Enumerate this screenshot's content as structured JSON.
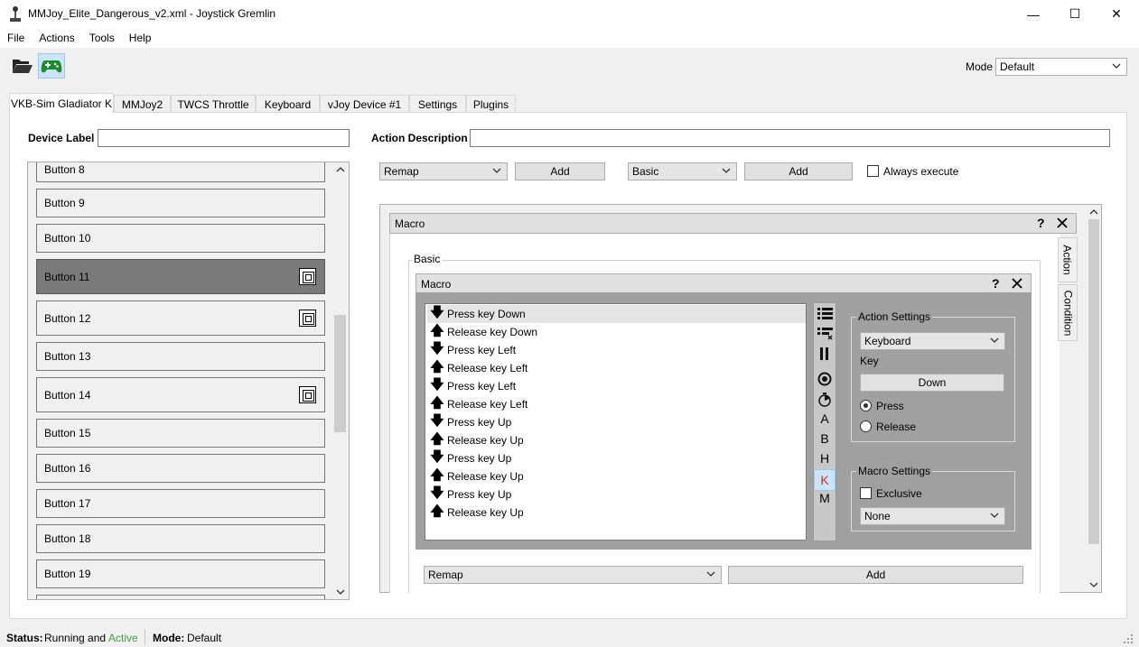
{
  "window": {
    "title": "MMJoy_Elite_Dangerous_v2.xml - Joystick Gremlin",
    "minimize": "—",
    "maximize": "☐",
    "close": "✕"
  },
  "menu": [
    "File",
    "Actions",
    "Tools",
    "Help"
  ],
  "toolbar": {
    "mode_label": "Mode",
    "mode_value": "Default"
  },
  "tabs": [
    "VKB-Sim Gladiator K",
    "MMJoy2",
    "TWCS Throttle",
    "Keyboard",
    "vJoy Device #1",
    "Settings",
    "Plugins"
  ],
  "left": {
    "device_label": "Device Label",
    "device_label_value": "",
    "buttons": [
      "Button 8",
      "Button 9",
      "Button 10",
      "Button 11",
      "Button 12",
      "Button 13",
      "Button 14",
      "Button 15",
      "Button 16",
      "Button 17",
      "Button 18",
      "Button 19"
    ],
    "selected": "Button 11",
    "with_condition_icon": [
      "Button 11",
      "Button 12",
      "Button 14"
    ]
  },
  "right": {
    "action_description": "Action Description",
    "action_description_value": "",
    "action_select": "Remap",
    "add_label": "Add",
    "container_select": "Basic",
    "container_add_label": "Add",
    "always_execute": "Always execute",
    "outer_header": "Macro",
    "basic_label": "Basic",
    "inner_header": "Macro",
    "vtabs": [
      "Action",
      "Condition"
    ],
    "steps": [
      {
        "dir": "down",
        "text": "Press key Down"
      },
      {
        "dir": "up",
        "text": "Release key Down"
      },
      {
        "dir": "down",
        "text": "Press key Left"
      },
      {
        "dir": "up",
        "text": "Release key Left"
      },
      {
        "dir": "down",
        "text": "Press key Left"
      },
      {
        "dir": "up",
        "text": "Release key Left"
      },
      {
        "dir": "down",
        "text": "Press key Up"
      },
      {
        "dir": "up",
        "text": "Release key Up"
      },
      {
        "dir": "down",
        "text": "Press key Up"
      },
      {
        "dir": "up",
        "text": "Release key Up"
      },
      {
        "dir": "down",
        "text": "Press key Up"
      },
      {
        "dir": "up",
        "text": "Release key Up"
      }
    ],
    "column_icons": [
      "list-icon",
      "list-remove-icon",
      "pause-icon",
      "record-icon",
      "timer-icon",
      "A",
      "B",
      "H",
      "K",
      "M"
    ],
    "action_settings": {
      "title": "Action Settings",
      "type": "Keyboard",
      "key_label": "Key",
      "key_value": "Down",
      "press": "Press",
      "release": "Release"
    },
    "macro_settings": {
      "title": "Macro Settings",
      "exclusive": "Exclusive",
      "repeat": "None"
    },
    "bottom_select": "Remap",
    "bottom_add": "Add"
  },
  "status": {
    "label": "Status:",
    "running": "Running and",
    "active": "Active",
    "mode_label": "Mode:",
    "mode_value": "Default",
    "active_color": "#3aa53a"
  }
}
